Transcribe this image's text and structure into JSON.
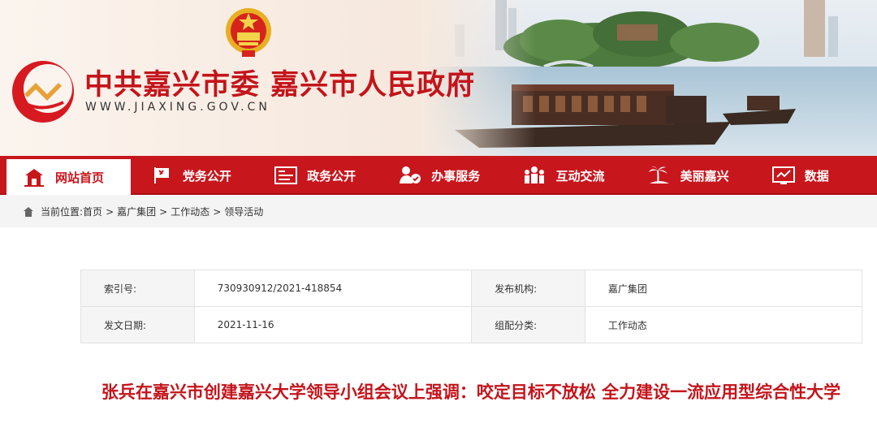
{
  "header": {
    "site_title": "中共嘉兴市委 嘉兴市人民政府",
    "site_url": "WWW.JIAXING.GOV.CN"
  },
  "nav": {
    "items": [
      {
        "label": "网站首页",
        "icon": "home-icon"
      },
      {
        "label": "党务公开",
        "icon": "party-flag-icon"
      },
      {
        "label": "政务公开",
        "icon": "document-list-icon"
      },
      {
        "label": "办事服务",
        "icon": "service-person-icon"
      },
      {
        "label": "互动交流",
        "icon": "people-group-icon"
      },
      {
        "label": "美丽嘉兴",
        "icon": "palm-tree-icon"
      },
      {
        "label": "数据",
        "icon": "data-chart-icon"
      }
    ]
  },
  "breadcrumb": {
    "prefix": "当前位置:",
    "items": [
      "首页",
      "嘉广集团",
      "工作动态",
      "领导活动"
    ],
    "separator": ">"
  },
  "info": {
    "index_label": "索引号:",
    "index_value": "730930912/2021-418854",
    "publisher_label": "发布机构:",
    "publisher_value": "嘉广集团",
    "date_label": "发文日期:",
    "date_value": "2021-11-16",
    "category_label": "组配分类:",
    "category_value": "工作动态"
  },
  "article": {
    "title": "张兵在嘉兴市创建嘉兴大学领导小组会议上强调：咬定目标不放松 全力建设一流应用型综合性大学"
  },
  "colors": {
    "brand_red": "#c8161d",
    "title_red": "#c4141b",
    "crumb_bg": "#f4f4f4",
    "label_bg": "#f5f5f5"
  }
}
